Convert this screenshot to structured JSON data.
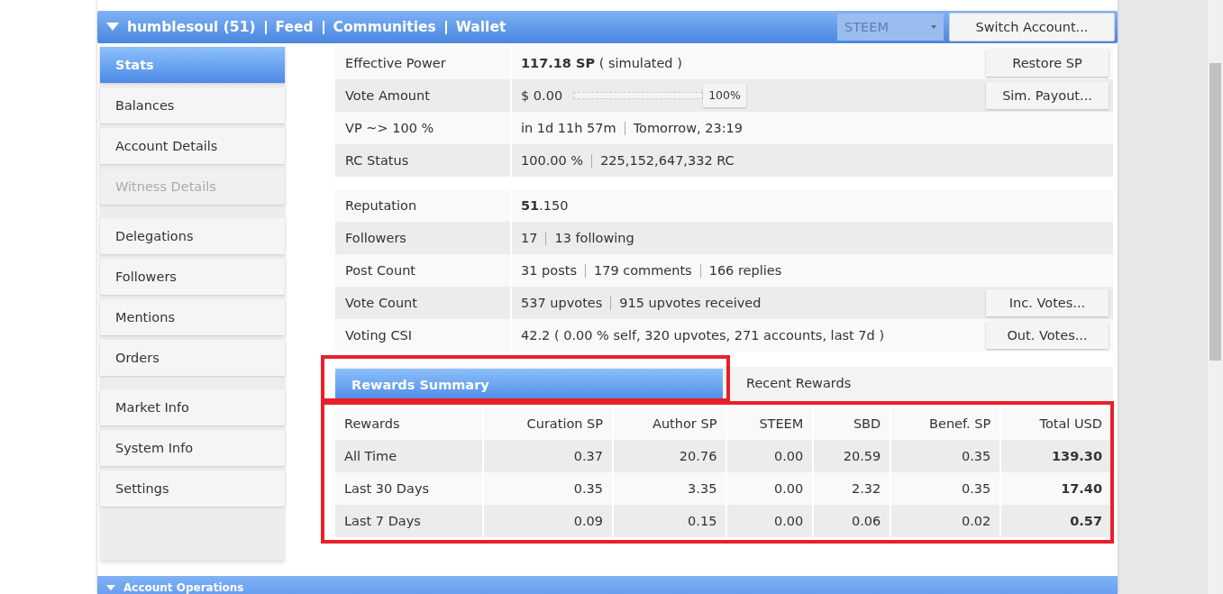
{
  "header": {
    "nav": [
      "humblesoul (51)",
      "Feed",
      "Communities",
      "Wallet"
    ],
    "currency": "STEEM",
    "switch_button": "Switch Account..."
  },
  "sidebar": {
    "groups": [
      [
        {
          "label": "Stats",
          "selected": true,
          "disabled": false
        },
        {
          "label": "Balances",
          "selected": false,
          "disabled": false
        },
        {
          "label": "Account Details",
          "selected": false,
          "disabled": false
        },
        {
          "label": "Witness Details",
          "selected": false,
          "disabled": true
        }
      ],
      [
        {
          "label": "Delegations",
          "selected": false,
          "disabled": false
        },
        {
          "label": "Followers",
          "selected": false,
          "disabled": false
        },
        {
          "label": "Mentions",
          "selected": false,
          "disabled": false
        },
        {
          "label": "Orders",
          "selected": false,
          "disabled": false
        }
      ],
      [
        {
          "label": "Market Info",
          "selected": false,
          "disabled": false
        },
        {
          "label": "System Info",
          "selected": false,
          "disabled": false
        },
        {
          "label": "Settings",
          "selected": false,
          "disabled": false
        }
      ]
    ]
  },
  "stats": [
    [
      {
        "kind": "text",
        "label": "Effective Power",
        "parts": [
          "**117.18 SP** ( simulated )"
        ],
        "button": "Restore SP"
      },
      {
        "kind": "slider",
        "label": "Vote Amount",
        "parts": [
          "$ 0.00"
        ],
        "level": 1.0,
        "reading": "100%",
        "button": "Sim. Payout..."
      },
      {
        "kind": "text",
        "label": "VP ~> 100 %",
        "parts": [
          "in 1d 11h 57m",
          "Tomorrow, 23:19"
        ]
      },
      {
        "kind": "text",
        "label": "RC Status",
        "parts": [
          "100.00 %",
          "225,152,647,332 RC"
        ]
      }
    ],
    [
      {
        "kind": "text",
        "label": "Reputation",
        "parts": [
          "**51**.150"
        ]
      },
      {
        "kind": "text",
        "label": "Followers",
        "parts": [
          "17",
          "13 following"
        ]
      },
      {
        "kind": "text",
        "label": "Post Count",
        "parts": [
          "31 posts",
          "179 comments",
          "166 replies"
        ]
      },
      {
        "kind": "text",
        "label": "Vote Count",
        "parts": [
          "537 upvotes",
          "915 upvotes received"
        ],
        "button": "Inc. Votes..."
      },
      {
        "kind": "text",
        "label": "Voting CSI",
        "parts": [
          "42.2 ( 0.00 % self, 320 upvotes, 271 accounts, last 7d )"
        ],
        "button": "Out. Votes..."
      }
    ]
  ],
  "rewards_tabs": {
    "highlighted": true,
    "tabs": [
      {
        "label": "Rewards Summary",
        "selected": true
      },
      {
        "label": "Recent Rewards",
        "selected": false
      }
    ]
  },
  "rewards_table": {
    "highlighted": true,
    "columns": [
      "Rewards",
      "Curation SP",
      "Author SP",
      "STEEM",
      "SBD",
      "Benef. SP",
      "Total USD"
    ],
    "rows": [
      [
        "All Time",
        "0.37",
        "20.76",
        "0.00",
        "20.59",
        "0.35",
        "139.30"
      ],
      [
        "Last 30 Days",
        "0.35",
        "3.35",
        "0.00",
        "2.32",
        "0.35",
        "17.40"
      ],
      [
        "Last 7 Days",
        "0.09",
        "0.15",
        "0.00",
        "0.06",
        "0.02",
        "0.57"
      ]
    ]
  },
  "next_section": {
    "title": "Account Operations"
  }
}
